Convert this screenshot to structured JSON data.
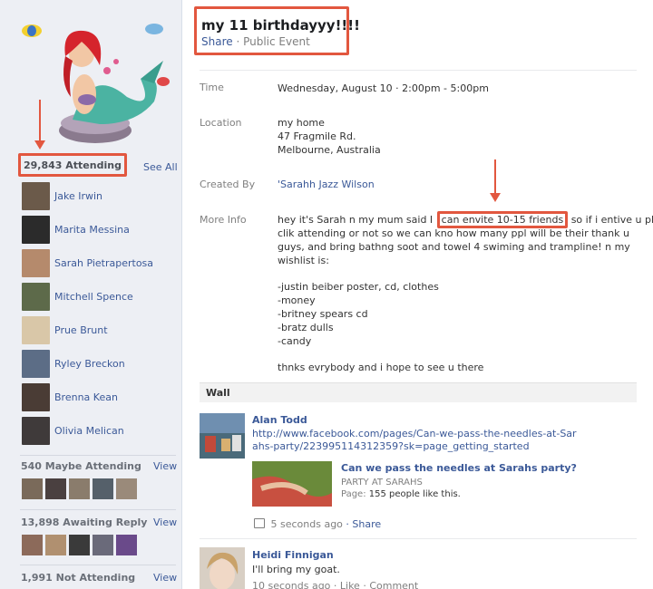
{
  "event": {
    "title": "my 11 birthdayyy!!!!",
    "share_label": "Share",
    "privacy": "· Public Event"
  },
  "details": {
    "time_label": "Time",
    "time_value": "Wednesday, August 10 · 2:00pm - 5:00pm",
    "location_label": "Location",
    "location_lines": [
      "my home",
      "47 Fragmile Rd.",
      "Melbourne, Australia"
    ],
    "created_by_label": "Created By",
    "created_by_value": "'Sarahh Jazz Wilson",
    "more_info_label": "More Info",
    "more_info_lines": [
      "hey it's Sarah n my mum said I",
      "clik attending or not so we can kno how many ppl will be their thank u",
      "guys, and bring bathng soot and towel 4 swiming and trampline! n my",
      "wishlist is:",
      "",
      "-justin beiber poster, cd, clothes",
      "-money",
      "-britney spears cd",
      "-bratz dulls",
      "-candy",
      "",
      "thnks evrybody and i hope to see u there"
    ],
    "more_info_highlight": "can envite 10-15 friends",
    "more_info_tail": "so if i entive u plz"
  },
  "sidebar": {
    "attending_count": "29,843 Attending",
    "see_all": "See All",
    "guests": [
      {
        "name": "Jake Irwin",
        "color": "#6b5a4a"
      },
      {
        "name": "Marita Messina",
        "color": "#2b2b2b"
      },
      {
        "name": "Sarah Pietrapertosa",
        "color": "#b58a6c"
      },
      {
        "name": "Mitchell Spence",
        "color": "#5d6a4a"
      },
      {
        "name": "Prue Brunt",
        "color": "#d9c7a8"
      },
      {
        "name": "Ryley Breckon",
        "color": "#5c6d86"
      },
      {
        "name": "Brenna Kean",
        "color": "#4a3c35"
      },
      {
        "name": "Olivia Melican",
        "color": "#3f3a3a"
      }
    ],
    "maybe": "540 Maybe Attending",
    "maybe_view": "View",
    "awaiting": "13,898 Awaiting Reply",
    "awaiting_view": "View",
    "not_attending": "1,991 Not Attending",
    "not_view": "View"
  },
  "wall": {
    "header": "Wall",
    "posts": [
      {
        "author": "Alan Todd",
        "link_lines": [
          "http://www.facebook.com/pages/Can-we-pass-the-needles-at-Sar",
          "ahs-party/223995114312359?sk=page_getting_started"
        ],
        "attachment_title": "Can we pass the needles at Sarahs party?",
        "attachment_sub": "PARTY AT SARAHS",
        "attachment_page_label": "Page:",
        "attachment_page": "155 people like this.",
        "time": "5 seconds ago",
        "share": "· Share"
      },
      {
        "author": "Heidi Finnigan",
        "text": "I'll bring my goat.",
        "meta": "10 seconds ago · Like · Comment"
      }
    ]
  }
}
